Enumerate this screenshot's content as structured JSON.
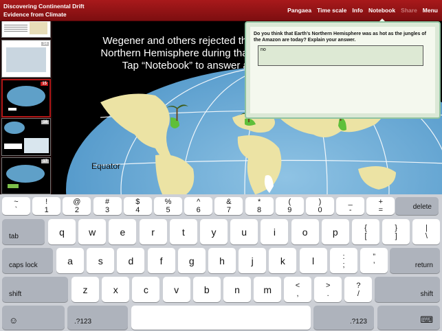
{
  "header": {
    "title": "Discovering Continental Drift",
    "subtitle": "Evidence from Climate",
    "nav": [
      {
        "label": "Pangaea",
        "state": "normal"
      },
      {
        "label": "Time scale",
        "state": "normal"
      },
      {
        "label": "Info",
        "state": "normal"
      },
      {
        "label": "Notebook",
        "state": "active"
      },
      {
        "label": "Share",
        "state": "disabled"
      },
      {
        "label": "Menu",
        "state": "normal"
      }
    ]
  },
  "sidebar": {
    "thumbnails": [
      {
        "number": "",
        "selected": false
      },
      {
        "number": "14",
        "selected": false
      },
      {
        "number": "15",
        "selected": true
      },
      {
        "number": "16",
        "selected": false
      },
      {
        "number": "17",
        "selected": false
      }
    ]
  },
  "slide": {
    "line1": "Wegener and others rejected this idea",
    "line2": "Northern Hemisphere during that same",
    "line3": "Tap “Notebook” to answer a q",
    "equator_label": "Equator"
  },
  "notebook": {
    "question": "Do you think that Earth’s Northern Hemisphere was as hot as the jungles of the Amazon are today? Explain your answer.",
    "answer": "no"
  },
  "keyboard": {
    "row1": [
      {
        "top": "~",
        "bottom": "`"
      },
      {
        "top": "!",
        "bottom": "1"
      },
      {
        "top": "@",
        "bottom": "2"
      },
      {
        "top": "#",
        "bottom": "3"
      },
      {
        "top": "$",
        "bottom": "4"
      },
      {
        "top": "%",
        "bottom": "5"
      },
      {
        "top": "^",
        "bottom": "6"
      },
      {
        "top": "&",
        "bottom": "7"
      },
      {
        "top": "*",
        "bottom": "8"
      },
      {
        "top": "(",
        "bottom": "9"
      },
      {
        "top": ")",
        "bottom": "0"
      },
      {
        "top": "_",
        "bottom": "-"
      },
      {
        "top": "+",
        "bottom": "="
      }
    ],
    "delete": "delete",
    "tab": "tab",
    "row2": [
      "q",
      "w",
      "e",
      "r",
      "t",
      "y",
      "u",
      "i",
      "o",
      "p"
    ],
    "row2_extra": [
      {
        "top": "{",
        "bottom": "["
      },
      {
        "top": "}",
        "bottom": "]"
      },
      {
        "top": "|",
        "bottom": "\\"
      }
    ],
    "caps": "caps lock",
    "row3": [
      "a",
      "s",
      "d",
      "f",
      "g",
      "h",
      "j",
      "k",
      "l"
    ],
    "row3_extra": [
      {
        "top": ":",
        "bottom": ";"
      },
      {
        "top": "”",
        "bottom": "’"
      }
    ],
    "return": "return",
    "shift": "shift",
    "row4": [
      "z",
      "x",
      "c",
      "v",
      "b",
      "n",
      "m"
    ],
    "row4_extra": [
      {
        "top": "<",
        "bottom": ","
      },
      {
        "top": ">",
        "bottom": "."
      },
      {
        "top": "?",
        "bottom": "/"
      }
    ],
    "emoji": "☺",
    "numbers": ".?123",
    "hide": "⌨"
  }
}
